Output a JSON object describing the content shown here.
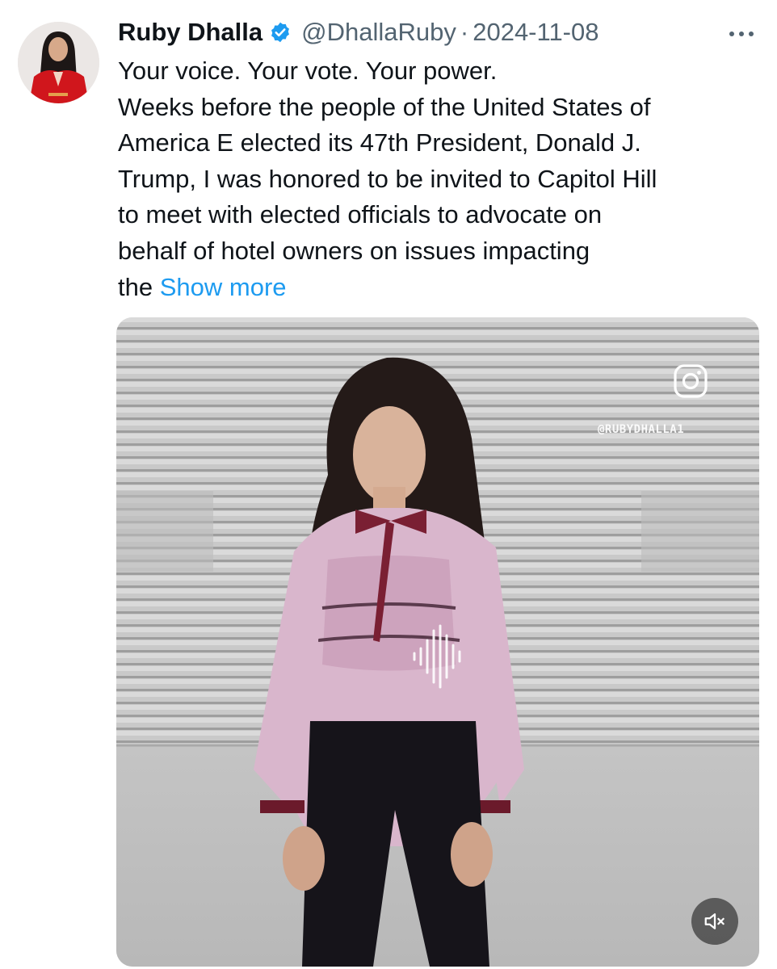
{
  "tweet": {
    "author_name": "Ruby Dhalla",
    "handle": "@DhallaRuby",
    "separator": "·",
    "date": "2024-11-08",
    "verified": true,
    "text_lines": [
      "Your voice. Your vote. Your power.",
      "Weeks before the people of the United States of",
      "America E elected its 47th President, Donald J.",
      "Trump, I was honored to be invited to Capitol Hill",
      "to meet with elected officials to advocate on",
      "behalf of hotel owners on issues impacting"
    ],
    "last_line_prefix": "the ",
    "show_more_label": "Show more"
  },
  "media": {
    "type": "video",
    "watermark_handle": "@RUBYDHALLA1",
    "muted": true
  },
  "icons": {
    "verified": "verified-badge-icon",
    "more": "more-options-icon",
    "instagram": "instagram-icon",
    "audio": "audio-wave-icon",
    "mute": "speaker-muted-icon"
  },
  "colors": {
    "link": "#1d9bf0",
    "secondary_text": "#536471",
    "primary_text": "#0f1419"
  }
}
